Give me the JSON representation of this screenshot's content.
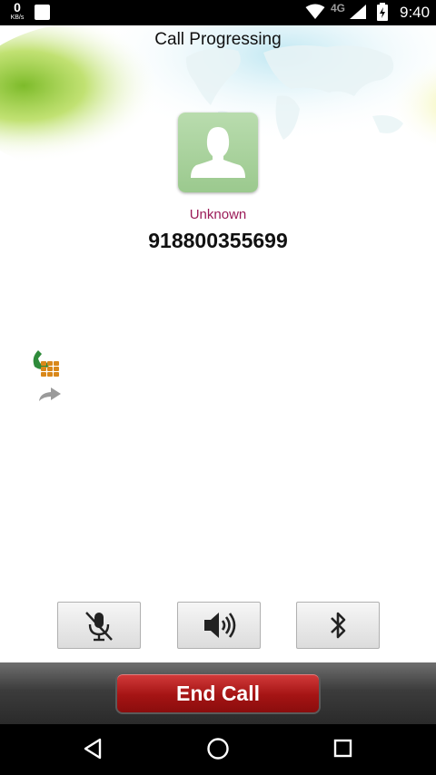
{
  "status_bar": {
    "speed_value": "0",
    "speed_unit": "KB/s",
    "network": "4G",
    "time": "9:40"
  },
  "call": {
    "status": "Call Progressing",
    "caller_name": "Unknown",
    "caller_number": "918800355699"
  },
  "controls": {
    "mute_icon": "mic-muted-icon",
    "speaker_icon": "speaker-icon",
    "bluetooth_icon": "bluetooth-icon"
  },
  "end_call": {
    "label": "End Call"
  },
  "colors": {
    "caller_name": "#9b1b58",
    "end_call": "#a51414",
    "avatar": "#a8d29b",
    "banner_green": "#8cc63f"
  }
}
